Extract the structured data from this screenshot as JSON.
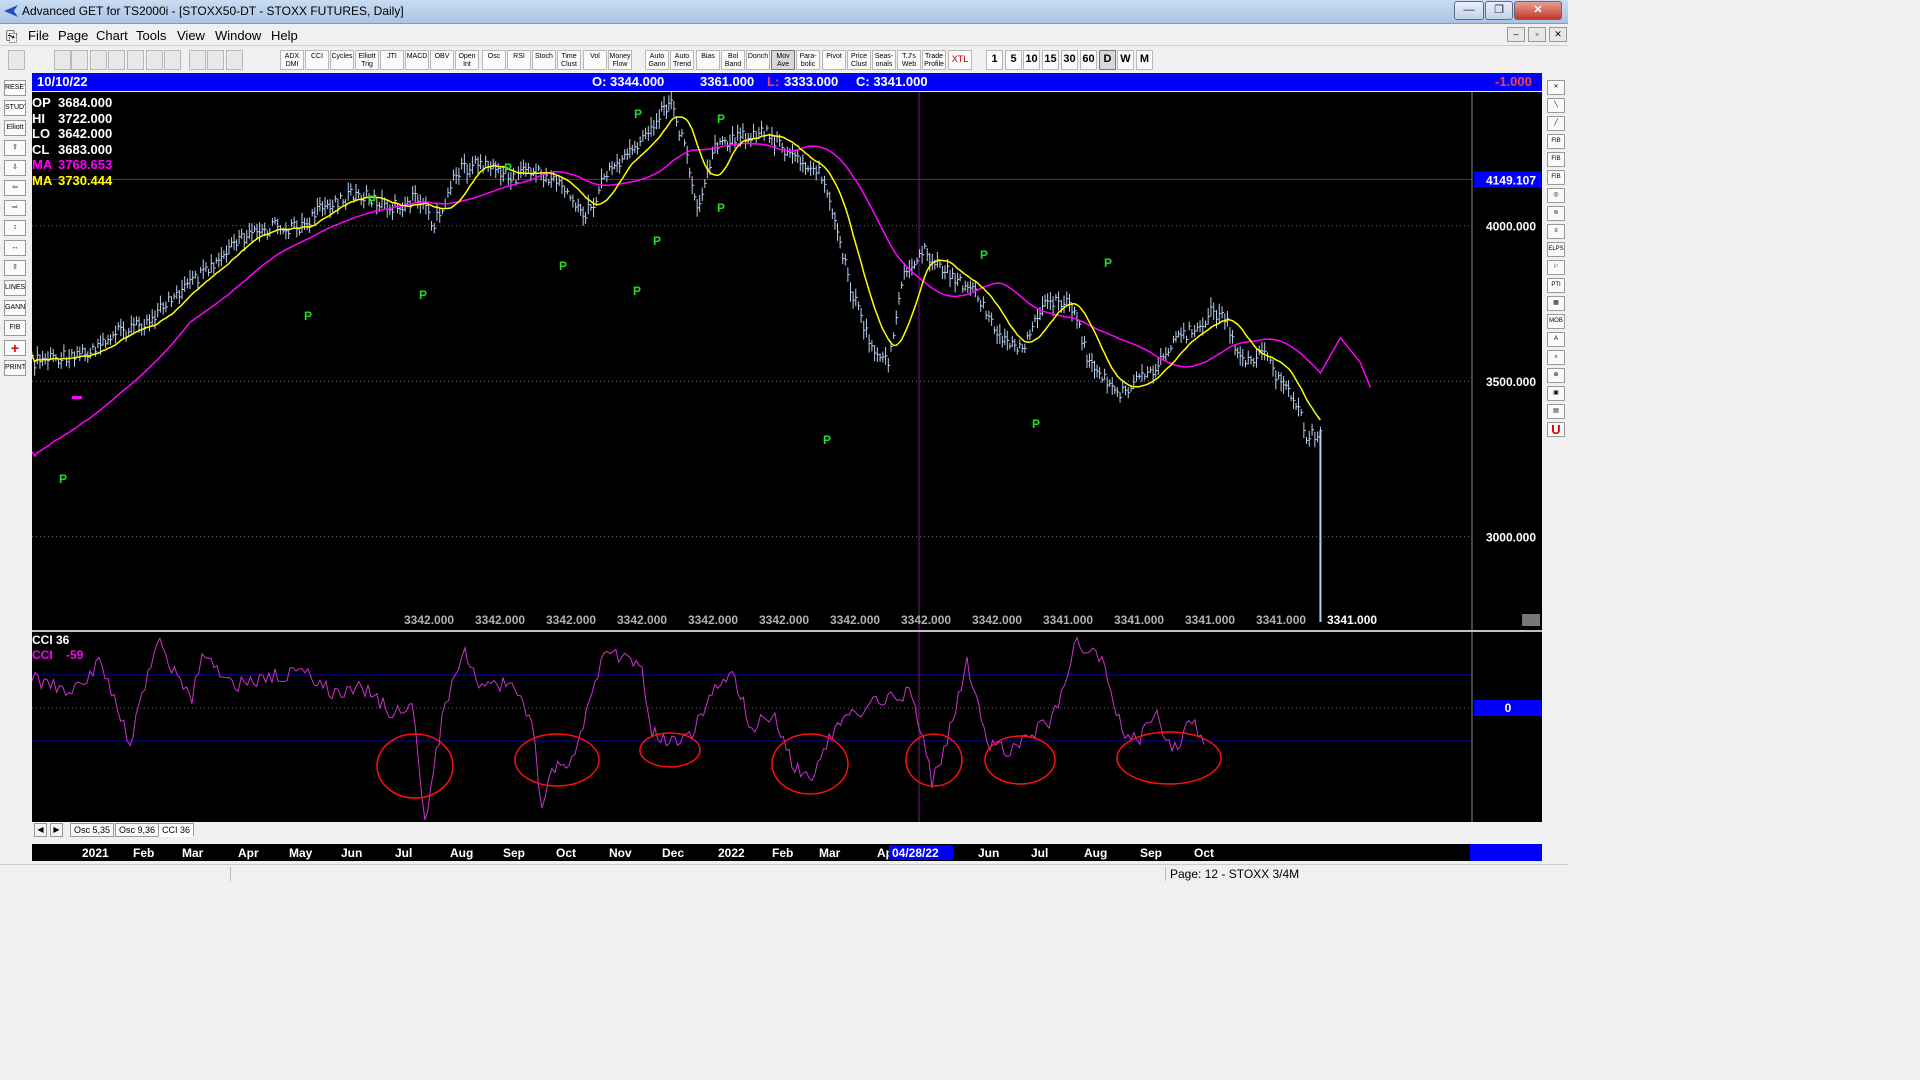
{
  "window": {
    "title": "Advanced GET for TS2000i - [STOXX50-DT - STOXX FUTURES, Daily]",
    "minimize_label": "—",
    "maximize_label": "❐",
    "close_label": "✕"
  },
  "menu": {
    "items": [
      "File",
      "Page",
      "Chart",
      "Tools",
      "View",
      "Window",
      "Help"
    ],
    "mdi_buttons": [
      "–",
      "▫",
      "✕"
    ]
  },
  "toolbar": {
    "indicator_buttons": [
      "ADX DMI",
      "CCI",
      "Cycles",
      "Elliott Trig",
      "JTI",
      "MACD",
      "OBV",
      "Open Int",
      "Osc",
      "RSI",
      "Stoch",
      "Time Clust",
      "Vol",
      "Money Flow",
      "Auto Gann",
      "Auto Trend",
      "Bias",
      "Bol Band",
      "Donch",
      "Mov Ave",
      "Para- bolic",
      "Pivot",
      "Price Clust",
      "Seas- onals",
      "T.J's Web",
      "Trade Profile",
      "XTL"
    ],
    "period_buttons": [
      "1",
      "5",
      "10",
      "15",
      "30",
      "60",
      "D",
      "W",
      "M"
    ],
    "active_period": "D"
  },
  "left_tools": [
    "RESET",
    "STUDY",
    "Elliott",
    "⇧",
    "⇩",
    "⇦",
    "⇨",
    "↕",
    "↔",
    "⇳",
    "LINES",
    "GANN",
    "FIB",
    "+",
    "PRINT"
  ],
  "right_tools": [
    "✕",
    "╲",
    "╱",
    "FIB RET",
    "FIB EXT",
    "FIB TIME",
    "◎",
    "≋",
    "≡",
    "ELPS",
    "⚐",
    "PTI",
    "▦",
    "MOB",
    "A",
    "⌕",
    "⊕",
    "▣",
    "▤",
    "U"
  ],
  "header": {
    "date": "10/10/22",
    "open": "O: 3344.000",
    "high": "3361.000",
    "low_label": "L:",
    "low_value": "3333.000",
    "close": "C: 3341.000",
    "change": "-1.000"
  },
  "price_pane": {
    "readout": [
      {
        "label": "OP",
        "value": "3684.000",
        "color": "#ffffff"
      },
      {
        "label": "HI",
        "value": "3722.000",
        "color": "#ffffff"
      },
      {
        "label": "LO",
        "value": "3642.000",
        "color": "#ffffff"
      },
      {
        "label": "CL",
        "value": "3683.000",
        "color": "#ffffff"
      },
      {
        "label": "MA",
        "value": "3768.653",
        "color": "#ff00ff"
      },
      {
        "label": "MA",
        "value": "3730.444",
        "color": "#ffff00"
      }
    ],
    "current_price_tag": "4149.107",
    "price_ticks": [
      "4000.000",
      "3500.000",
      "3000.000"
    ],
    "bottom_labels": [
      "3342.000",
      "3342.000",
      "3342.000",
      "3342.000",
      "3342.000",
      "3342.000",
      "3342.000",
      "3342.000",
      "3342.000",
      "3341.000",
      "3341.000",
      "3341.000",
      "3341.000",
      "3341.000"
    ],
    "pivot_marker": "P"
  },
  "cci_pane": {
    "title": "CCI 36",
    "readout_label": "CCI",
    "readout_value": "-59",
    "zero_label": "0"
  },
  "osc_tabs": {
    "scroll_left": "◀",
    "scroll_right": "▶",
    "tabs": [
      "Osc 5,35",
      "Osc 9,36",
      "CCI 36"
    ],
    "selected": "CCI 36"
  },
  "date_axis": {
    "labels": [
      "2021",
      "Feb",
      "Mar",
      "Apr",
      "May",
      "Jun",
      "Jul",
      "Aug",
      "Sep",
      "Oct",
      "Nov",
      "Dec",
      "2022",
      "Feb",
      "Mar",
      "Ap",
      "r",
      "Jun",
      "Jul",
      "Aug",
      "Sep",
      "Oct"
    ],
    "cursor_date": "04/28/22"
  },
  "status": {
    "page": "Page: 12 - STOXX 3/4M"
  },
  "chart_data": {
    "type": "line",
    "title": "STOXX50-DT - STOXX FUTURES, Daily",
    "xlabel": "",
    "ylabel": "",
    "x_range": [
      "2021-01",
      "2022-10-10"
    ],
    "ylim": [
      2700,
      4430
    ],
    "grid": true,
    "series": [
      {
        "name": "",
        "color": "#b8d0f0",
        "x": [
          "2021-01-01",
          "2021-01-29",
          "2021-02-12",
          "2021-03-01",
          "2021-03-12",
          "2021-04-01",
          "2021-04-15",
          "2021-05-03",
          "2021-05-14",
          "2021-06-01",
          "2021-06-14",
          "2021-07-01",
          "2021-07-15",
          "2021-07-22",
          "2021-08-02",
          "2021-08-13",
          "2021-09-01",
          "2021-09-06",
          "2021-09-20",
          "2021-10-01",
          "2021-10-06",
          "2021-10-18",
          "2021-11-01",
          "2021-11-12",
          "2021-11-18",
          "2021-11-26",
          "2021-12-01",
          "2021-12-10",
          "2021-12-20",
          "2022-01-05",
          "2022-01-14",
          "2022-01-27",
          "2022-02-03",
          "2022-02-16",
          "2022-02-24",
          "2022-03-07",
          "2022-03-15",
          "2022-03-24",
          "2022-04-07",
          "2022-04-21",
          "2022-05-02",
          "2022-05-12",
          "2022-05-26",
          "2022-06-06",
          "2022-06-16",
          "2022-06-30",
          "2022-07-11",
          "2022-07-18",
          "2022-08-01",
          "2022-08-16",
          "2022-08-23",
          "2022-09-01",
          "2022-09-12",
          "2022-09-19",
          "2022-09-29",
          "2022-10-03",
          "2022-10-10"
        ],
        "values": [
          3560,
          3600,
          3650,
          3700,
          3770,
          3860,
          3950,
          4000,
          3990,
          4080,
          4100,
          4060,
          4090,
          4000,
          4170,
          4200,
          4160,
          4180,
          4150,
          4080,
          4030,
          4180,
          4250,
          4360,
          4400,
          4220,
          4060,
          4260,
          4280,
          4310,
          4230,
          4190,
          4150,
          3800,
          3650,
          3550,
          3850,
          3920,
          3850,
          3780,
          3650,
          3600,
          3750,
          3770,
          3560,
          3460,
          3510,
          3540,
          3640,
          3720,
          3700,
          3560,
          3590,
          3510,
          3430,
          3310,
          3341
        ]
      }
    ],
    "moving_averages": [
      {
        "name": "MA",
        "color": "#ff00ff",
        "last_value": 3768.653
      },
      {
        "name": "MA",
        "color": "#ffff00",
        "last_value": 3730.444
      }
    ],
    "cci": {
      "name": "CCI 36",
      "last_value": -59,
      "reference_lines": [
        100,
        0,
        -100
      ]
    }
  }
}
